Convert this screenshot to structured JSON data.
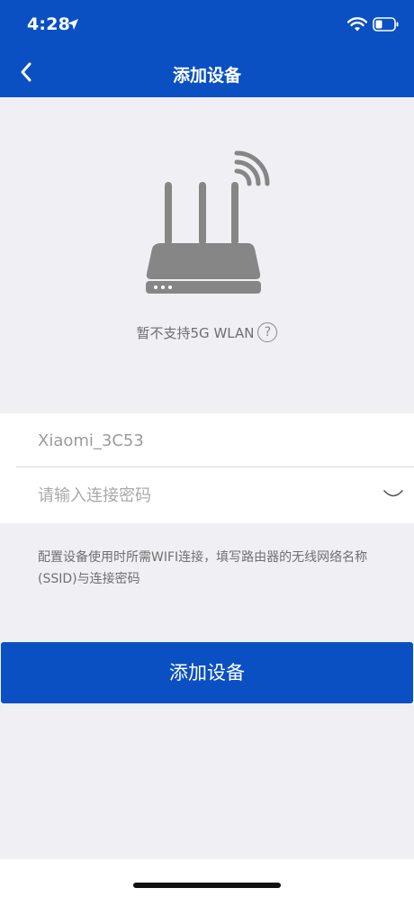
{
  "status_bar": {
    "time": "4:28"
  },
  "nav": {
    "title": "添加设备",
    "back_icon": "chevron-left-icon"
  },
  "router_panel": {
    "icon": "router-icon",
    "no_5g_text": "暂不支持5G WLAN",
    "help_glyph": "?"
  },
  "form": {
    "ssid_value": "Xiaomi_3C53",
    "password_placeholder": "请输入连接密码"
  },
  "hint": "配置设备使用时所需WIFI连接，填写路由器的无线网络名称(SSID)与连接密码",
  "submit_label": "添加设备",
  "colors": {
    "brand": "#0a50c2",
    "background": "#efeff4"
  }
}
